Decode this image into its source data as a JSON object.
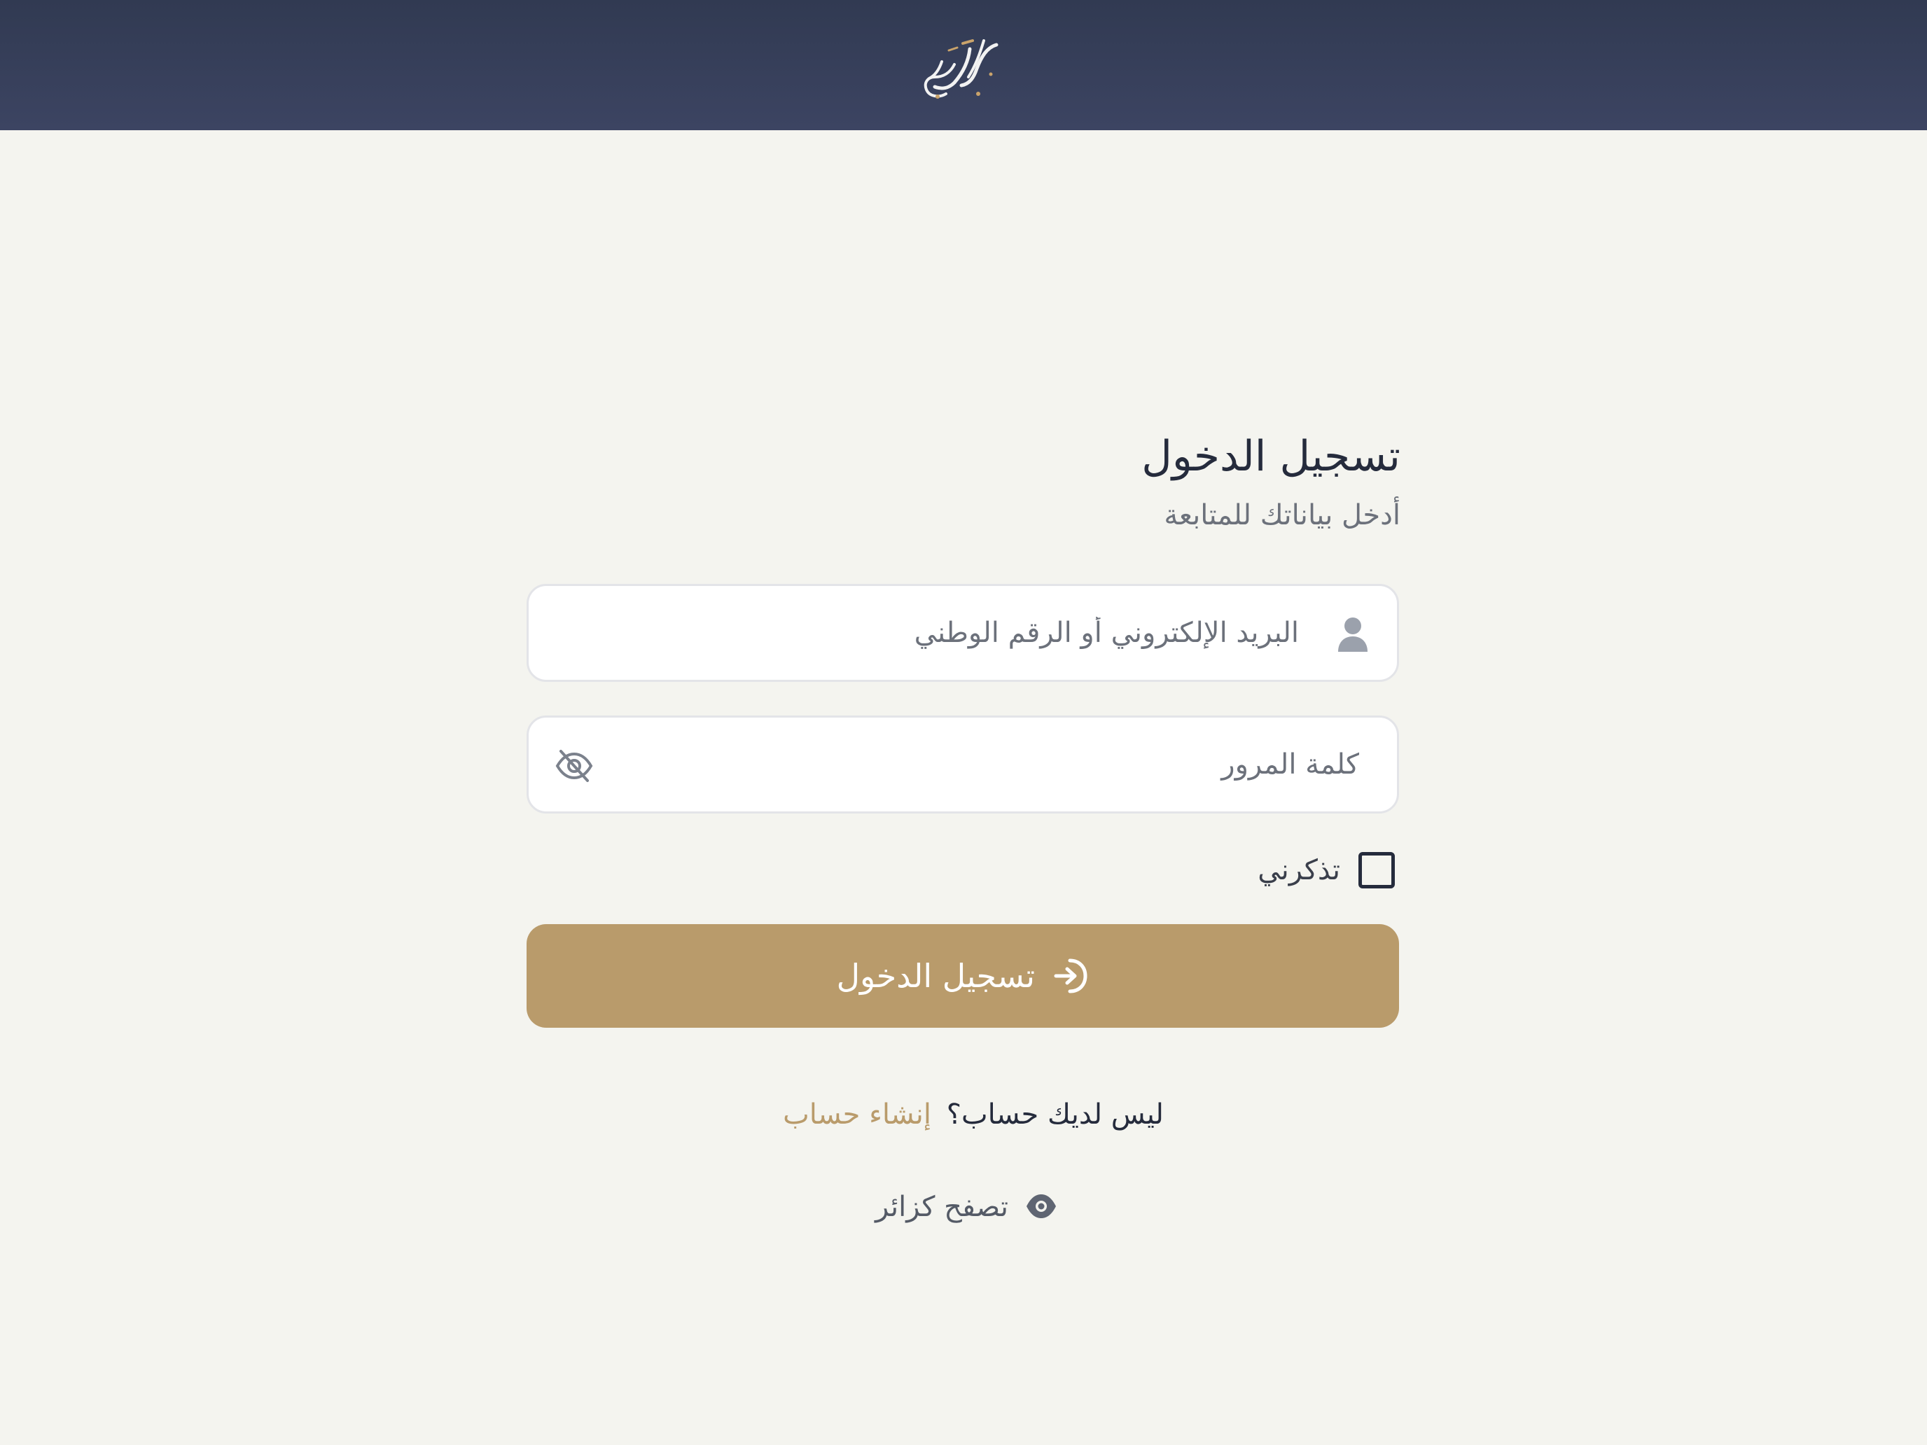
{
  "header": {
    "logo_icon": "calligraphy-logo",
    "background_color": "#343c56"
  },
  "login": {
    "title": "تسجيل الدخول",
    "subtitle": "أدخل بياناتك للمتابعة",
    "email_field": {
      "placeholder": "البريد الإلكتروني أو الرقم الوطني",
      "value": "",
      "icon": "user-icon"
    },
    "password_field": {
      "placeholder": "كلمة المرور",
      "value": "",
      "icon": "eye-off-icon"
    },
    "remember_me": {
      "label": "تذكرني",
      "checked": false
    },
    "submit": {
      "label": "تسجيل الدخول",
      "icon": "login-icon"
    },
    "signup": {
      "question": "ليس لديك حساب؟",
      "link_label": "إنشاء حساب"
    },
    "guest": {
      "label": "تصفح كزائر",
      "icon": "eye-icon"
    }
  },
  "colors": {
    "accent": "#b99b6b",
    "page_background": "#f4f4ef",
    "text_primary": "#252b3c",
    "text_muted": "#6c717b"
  }
}
